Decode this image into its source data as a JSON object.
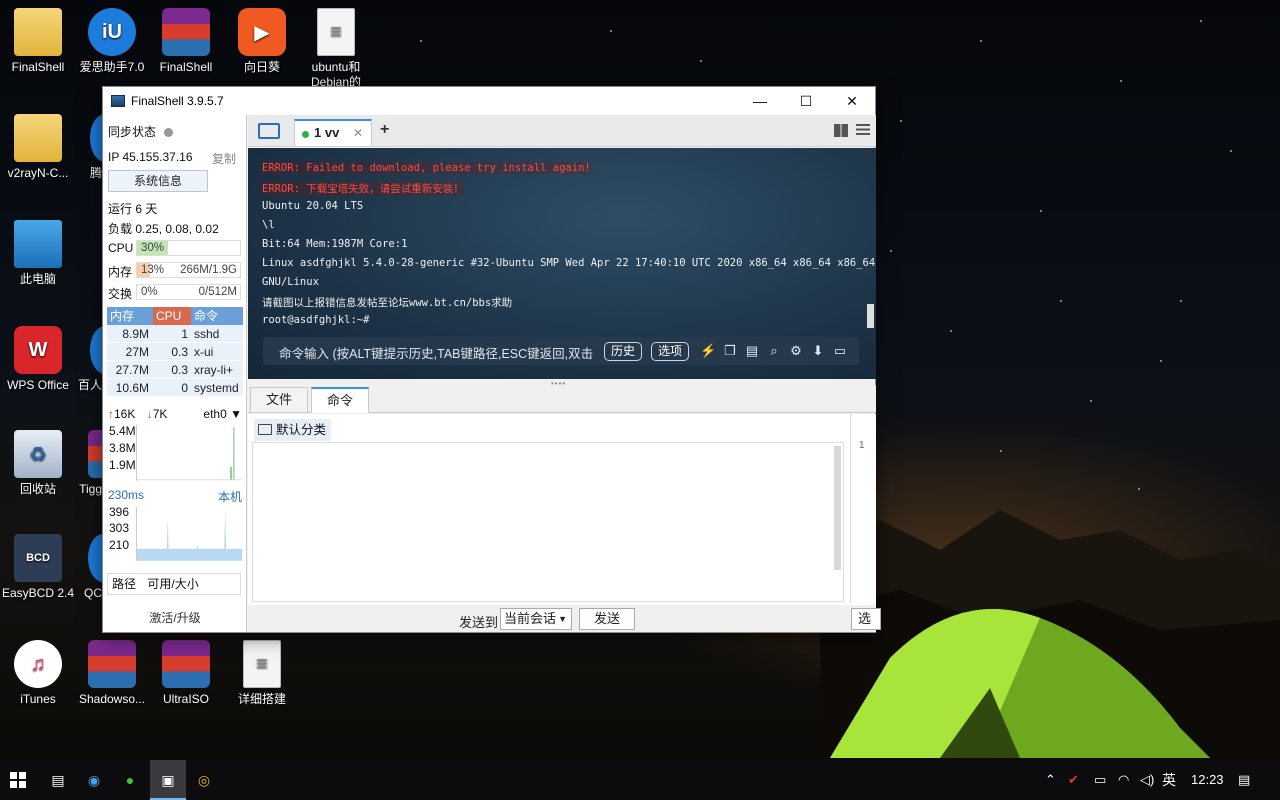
{
  "desktop": {
    "icons": [
      {
        "label": "FinalShell",
        "icon": "folder-icon"
      },
      {
        "label": "爱思助手7.0",
        "icon": "aisi-icon"
      },
      {
        "label": "FinalShell",
        "icon": "winrar-icon"
      },
      {
        "label": "向日葵",
        "icon": "sunflower-icon"
      },
      {
        "label": "ubuntu和Debian的",
        "icon": "text-doc-icon"
      },
      {
        "label": "v2rayN-C...",
        "icon": "folder-icon"
      },
      {
        "label": "腾",
        "icon": "app-icon"
      },
      {
        "label": "此电脑",
        "icon": "this-pc-icon"
      },
      {
        "label": "WPS Office",
        "icon": "wps-icon"
      },
      {
        "label": "百人",
        "icon": "app-icon"
      },
      {
        "label": "回收站",
        "icon": "recycle-bin-icon"
      },
      {
        "label": "Tigg",
        "icon": "winrar-icon"
      },
      {
        "label": "EasyBCD 2.4",
        "icon": "easybcd-icon"
      },
      {
        "label": "QC",
        "icon": "app-icon"
      },
      {
        "label": "iTunes",
        "icon": "itunes-icon"
      },
      {
        "label": "Shadowso...",
        "icon": "winrar-icon"
      },
      {
        "label": "UltraISO",
        "icon": "winrar-icon"
      },
      {
        "label": "详细搭建",
        "icon": "text-doc-icon"
      }
    ]
  },
  "window": {
    "title": "FinalShell 3.9.5.7",
    "min": "—",
    "max": "☐",
    "close": "✕"
  },
  "left": {
    "sync_label": "同步状态",
    "ip": "IP 45.155.37.16",
    "copy": "复制",
    "sysinfo_button": "系统信息",
    "uptime": "运行 6 天",
    "load": "负载 0.25, 0.08, 0.02",
    "cpu_label": "CPU",
    "cpu_value": "30%",
    "cpu_percent": 30,
    "mem_label": "内存",
    "mem_percent_text": "13%",
    "mem_detail": "266M/1.9G",
    "mem_percent": 13,
    "swap_label": "交换",
    "swap_percent_text": "0%",
    "swap_detail": "0/512M",
    "proc_headers": [
      "内存",
      "CPU",
      "命令"
    ],
    "processes": [
      {
        "mem": "8.9M",
        "cpu": "1",
        "cmd": "sshd"
      },
      {
        "mem": "27M",
        "cpu": "0.3",
        "cmd": "x-ui"
      },
      {
        "mem": "27.7M",
        "cpu": "0.3",
        "cmd": "xray-li+"
      },
      {
        "mem": "10.6M",
        "cpu": "0",
        "cmd": "systemd"
      }
    ],
    "net_up": "16K",
    "net_down": "7K",
    "iface": "eth0",
    "net_ticks": [
      "5.4M",
      "3.8M",
      "1.9M"
    ],
    "latency": "230ms",
    "host": "本机",
    "latency_ticks": [
      "396",
      "303",
      "210"
    ],
    "disk_headers": [
      "路径",
      "可用/大小"
    ],
    "activate": "激活/升级"
  },
  "tabs": {
    "active_label": "1 vv",
    "close": "✕",
    "add": "+"
  },
  "terminal": {
    "lines": [
      {
        "text": "ERROR: Failed to download, please try install again!",
        "type": "err"
      },
      {
        "text": "ERROR: 下载宝塔失败，请尝试重新安装！",
        "type": "err"
      },
      {
        "text": "Ubuntu 20.04 LTS",
        "type": "out"
      },
      {
        "text": " \\l",
        "type": "out"
      },
      {
        "text": "Bit:64 Mem:1987M Core:1",
        "type": "out"
      },
      {
        "text": "Linux asdfghjkl 5.4.0-28-generic #32-Ubuntu SMP Wed Apr 22 17:40:10 UTC 2020 x86_64 x86_64 x86_64",
        "type": "out"
      },
      {
        "text": "GNU/Linux",
        "type": "out"
      },
      {
        "text": "请截图以上报错信息发帖至论坛www.bt.cn/bbs求助",
        "type": "out"
      },
      {
        "text": "root@asdfghjkl:~#",
        "type": "out"
      }
    ],
    "cmd_placeholder": "命令输入 (按ALT键提示历史,TAB键路径,ESC键返回,双击",
    "history_btn": "历史",
    "options_btn": "选项"
  },
  "bottom": {
    "tab_files": "文件",
    "tab_commands": "命令",
    "category": "默认分类",
    "line_no": "1",
    "send_to": "发送到",
    "target": "当前会话",
    "send": "发送",
    "options": "选项"
  },
  "taskbar": {
    "lang": "英",
    "time": "12:23"
  }
}
